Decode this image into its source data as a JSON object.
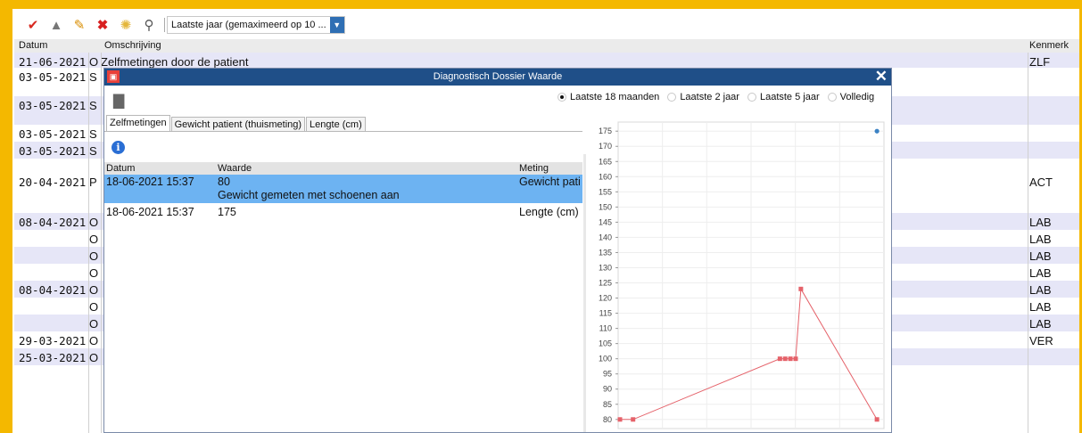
{
  "toolbar": {
    "period_value": "Laatste jaar (gemaximeerd op 10 ...",
    "icons": [
      "check-edit-icon",
      "stamp-icon",
      "pencil-icon",
      "delete-icon",
      "group-icon",
      "search-icon"
    ]
  },
  "grid": {
    "headers": {
      "datum": "Datum",
      "omschrijving": "Omschrijving",
      "kenmerk": "Kenmerk"
    },
    "rows": [
      {
        "date": "21-06-2021",
        "type": "O",
        "text": "Zelfmetingen door de patient",
        "kenmerk": "ZLF"
      },
      {
        "date": "03-05-2021",
        "type": "S",
        "text": "",
        "kenmerk": ""
      },
      {
        "date": "03-05-2021",
        "type": "S",
        "text": "",
        "kenmerk": ""
      },
      {
        "date": "03-05-2021",
        "type": "S",
        "text": "",
        "kenmerk": ""
      },
      {
        "date": "03-05-2021",
        "type": "S",
        "text": "",
        "kenmerk": ""
      },
      {
        "date": "20-04-2021",
        "type": "P",
        "text": "",
        "kenmerk": "ACT"
      },
      {
        "date": "08-04-2021",
        "type": "O",
        "text": "",
        "kenmerk": "LAB"
      },
      {
        "date": "",
        "type": "O",
        "text": "",
        "kenmerk": "LAB"
      },
      {
        "date": "",
        "type": "O",
        "text": "",
        "kenmerk": "LAB"
      },
      {
        "date": "",
        "type": "O",
        "text": "",
        "kenmerk": "LAB"
      },
      {
        "date": "08-04-2021",
        "type": "O",
        "text": "",
        "kenmerk": "LAB"
      },
      {
        "date": "",
        "type": "O",
        "text": "",
        "kenmerk": "LAB"
      },
      {
        "date": "",
        "type": "O",
        "text": "",
        "kenmerk": "LAB"
      },
      {
        "date": "29-03-2021",
        "type": "O",
        "text": "",
        "kenmerk": "VER"
      },
      {
        "date": "25-03-2021",
        "type": "O",
        "text": "",
        "kenmerk": ""
      }
    ]
  },
  "dialog": {
    "title": "Diagnostisch Dossier Waarde",
    "radios": [
      {
        "label": "Laatste 18 maanden",
        "selected": true
      },
      {
        "label": "Laatste 2 jaar",
        "selected": false
      },
      {
        "label": "Laatste 5 jaar",
        "selected": false
      },
      {
        "label": "Volledig",
        "selected": false
      }
    ],
    "tabs": [
      "Zelfmetingen",
      "Gewicht patient (thuismeting)",
      "Lengte (cm)"
    ],
    "table": {
      "headers": {
        "datum": "Datum",
        "waarde": "Waarde",
        "meting": "Meting"
      },
      "rows": [
        {
          "datum": "18-06-2021 15:37",
          "waarde": "80",
          "note": "Gewicht gemeten met schoenen aan",
          "meting": "Gewicht pati",
          "selected": true
        },
        {
          "datum": "18-06-2021 15:37",
          "waarde": "175",
          "note": "",
          "meting": "Lengte (cm)",
          "selected": false
        }
      ]
    }
  },
  "chart_data": {
    "type": "line",
    "ylim": [
      77,
      178
    ],
    "yticks": [
      80,
      85,
      90,
      95,
      100,
      105,
      110,
      115,
      120,
      125,
      130,
      135,
      140,
      145,
      150,
      155,
      160,
      165,
      170,
      175
    ],
    "series": [
      {
        "color": "#e5626a",
        "points": [
          [
            0.0,
            80
          ],
          [
            0.05,
            80
          ],
          [
            0.61,
            100
          ],
          [
            0.63,
            100
          ],
          [
            0.65,
            100
          ],
          [
            0.67,
            100
          ],
          [
            0.69,
            123
          ],
          [
            0.98,
            80
          ]
        ]
      },
      {
        "color": "#3b82c4",
        "points": [
          [
            0.98,
            175
          ]
        ]
      }
    ],
    "grid": true
  }
}
